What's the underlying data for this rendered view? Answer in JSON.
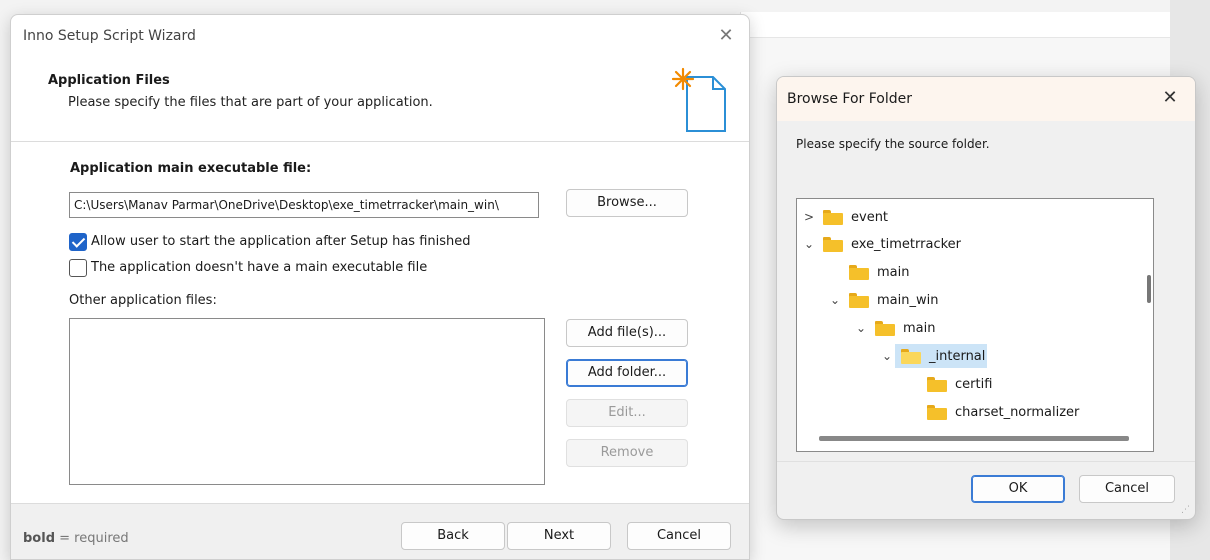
{
  "wizard": {
    "title": "Inno Setup Script Wizard",
    "heading": "Application Files",
    "subheading": "Please specify the files that are part of your application.",
    "main_exe_label": "Application main executable file:",
    "main_exe_value": "C:\\Users\\Manav Parmar\\OneDrive\\Desktop\\exe_timetrracker\\main_win\\",
    "browse_label": "Browse...",
    "allow_start_label": "Allow user to start the application after Setup has finished",
    "allow_start_checked": true,
    "no_main_exe_label": "The application doesn't have a main executable file",
    "no_main_exe_checked": false,
    "other_files_label": "Other application files:",
    "add_files_label": "Add file(s)...",
    "add_folder_label": "Add folder...",
    "edit_label": "Edit...",
    "remove_label": "Remove",
    "hint_bold": "bold",
    "hint_rest": " = required",
    "back_label": "Back",
    "next_label": "Next",
    "cancel_label": "Cancel"
  },
  "browse": {
    "title": "Browse For Folder",
    "prompt": "Please specify the source folder.",
    "tree": [
      {
        "label": "event",
        "chevron": ">",
        "open": false
      },
      {
        "label": "exe_timetrracker",
        "chevron": "v",
        "open": false
      },
      {
        "label": "main",
        "chevron": "",
        "open": false
      },
      {
        "label": "main_win",
        "chevron": "v",
        "open": false
      },
      {
        "label": "main",
        "chevron": "v",
        "open": false
      },
      {
        "label": "_internal",
        "chevron": "v",
        "open": true,
        "selected": true
      },
      {
        "label": "certifi",
        "chevron": "",
        "open": false
      },
      {
        "label": "charset_normalizer",
        "chevron": "",
        "open": false
      }
    ],
    "ok_label": "OK",
    "cancel_label": "Cancel"
  },
  "colors": {
    "accent": "#1f64c9",
    "selection": "#cce4f7",
    "folder": "#f5c02a"
  }
}
